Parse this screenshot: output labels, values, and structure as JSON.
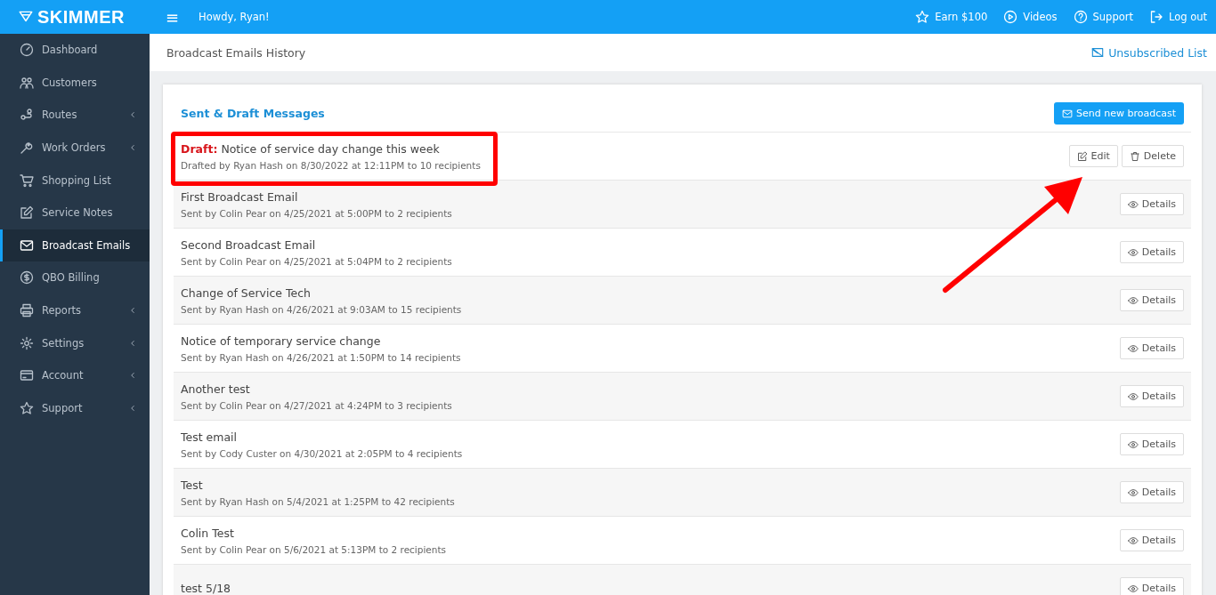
{
  "brand": {
    "name": "SKIMMER"
  },
  "topbar": {
    "menu_glyph": "≡",
    "greeting": "Howdy, Ryan!",
    "links": [
      "Earn $100",
      "Videos",
      "Support",
      "Log out"
    ]
  },
  "sidebar": {
    "items": [
      {
        "label": "Dashboard",
        "expandable": false,
        "selected": false
      },
      {
        "label": "Customers",
        "expandable": false,
        "selected": false
      },
      {
        "label": "Routes",
        "expandable": true,
        "selected": false
      },
      {
        "label": "Work Orders",
        "expandable": true,
        "selected": false
      },
      {
        "label": "Shopping List",
        "expandable": false,
        "selected": false
      },
      {
        "label": "Service Notes",
        "expandable": false,
        "selected": false
      },
      {
        "label": "Broadcast Emails",
        "expandable": false,
        "selected": true
      },
      {
        "label": "QBO Billing",
        "expandable": false,
        "selected": false
      },
      {
        "label": "Reports",
        "expandable": true,
        "selected": false
      },
      {
        "label": "Settings",
        "expandable": true,
        "selected": false
      },
      {
        "label": "Account",
        "expandable": true,
        "selected": false
      },
      {
        "label": "Support",
        "expandable": true,
        "selected": false
      }
    ]
  },
  "page": {
    "title": "Broadcast Emails History",
    "unsubscribed_link": "Unsubscribed List"
  },
  "card": {
    "title": "Sent & Draft Messages",
    "send_button": "Send new broadcast"
  },
  "messages": [
    {
      "kind": "draft",
      "draft_label": "Draft:",
      "title": "Notice of service day change this week",
      "meta": "Drafted by Ryan Hash on 8/30/2022 at 12:11PM to 10 recipients",
      "actions": [
        "Edit",
        "Delete"
      ]
    },
    {
      "kind": "sent",
      "title": "First Broadcast Email",
      "meta": "Sent by Colin Pear on 4/25/2021 at 5:00PM to 2 recipients",
      "actions": [
        "Details"
      ]
    },
    {
      "kind": "sent",
      "title": "Second Broadcast Email",
      "meta": "Sent by Colin Pear on 4/25/2021 at 5:04PM to 2 recipients",
      "actions": [
        "Details"
      ]
    },
    {
      "kind": "sent",
      "title": "Change of Service Tech",
      "meta": "Sent by Ryan Hash on 4/26/2021 at 9:03AM to 15 recipients",
      "actions": [
        "Details"
      ]
    },
    {
      "kind": "sent",
      "title": "Notice of temporary service change",
      "meta": "Sent by Ryan Hash on 4/26/2021 at 1:50PM to 14 recipients",
      "actions": [
        "Details"
      ]
    },
    {
      "kind": "sent",
      "title": "Another test",
      "meta": "Sent by Colin Pear on 4/27/2021 at 4:24PM to 3 recipients",
      "actions": [
        "Details"
      ]
    },
    {
      "kind": "sent",
      "title": "Test email",
      "meta": "Sent by Cody Custer on 4/30/2021 at 2:05PM to 4 recipients",
      "actions": [
        "Details"
      ]
    },
    {
      "kind": "sent",
      "title": "Test",
      "meta": "Sent by Ryan Hash on 5/4/2021 at 1:25PM to 42 recipients",
      "actions": [
        "Details"
      ]
    },
    {
      "kind": "sent",
      "title": "Colin Test",
      "meta": "Sent by Colin Pear on 5/6/2021 at 5:13PM to 2 recipients",
      "actions": [
        "Details"
      ]
    },
    {
      "kind": "sent",
      "title": "test 5/18",
      "actions": [
        "Details"
      ]
    }
  ]
}
